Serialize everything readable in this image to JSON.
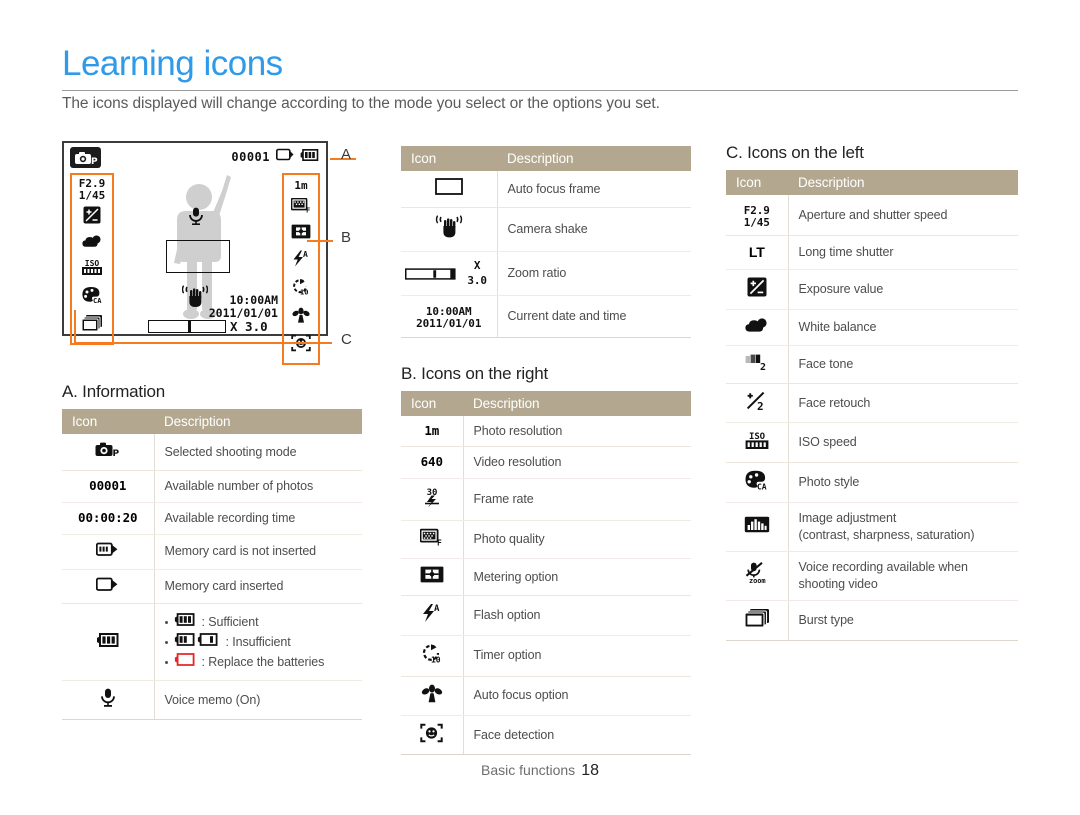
{
  "page": {
    "title": "Learning icons",
    "intro": "The icons displayed will change according to the mode you select or the options you set.",
    "footer_label": "Basic functions",
    "footer_page": "18",
    "accent_color": "#2f9ae8",
    "callout_color": "#f47b20",
    "table_header_color": "#b3a88f"
  },
  "lcd": {
    "mode_icon": "camera-program-mode-icon",
    "shots_remaining": "00001",
    "memory_card_icon": "memory-card-inserted-icon",
    "battery_icon": "battery-full-icon",
    "aperture": "F2.9",
    "shutter": "1/45",
    "zoom_ratio": "X 3.0",
    "time": "10:00AM",
    "date": "2011/01/01",
    "left_icons": [
      "exposure-value-icon",
      "white-balance-cloudy-icon",
      "iso-speed-icon",
      "photo-style-icon",
      "burst-type-icon"
    ],
    "right_icons": [
      "photo-resolution-1m-icon",
      "photo-quality-fine-icon",
      "metering-option-icon",
      "flash-auto-icon",
      "timer-10s-icon",
      "macro-af-icon",
      "face-detection-icon"
    ],
    "callouts": [
      {
        "label": "A",
        "target": "information-row"
      },
      {
        "label": "B",
        "target": "icons-on-the-right"
      },
      {
        "label": "C",
        "target": "icons-on-the-left"
      }
    ]
  },
  "tables": {
    "common_headers": {
      "icon": "Icon",
      "description": "Description"
    },
    "information": {
      "heading": "A. Information",
      "rows": [
        {
          "icon": "camera-program-mode-icon",
          "icon_text": "",
          "description": "Selected shooting mode"
        },
        {
          "icon": "shots-remaining-counter",
          "icon_text": "00001",
          "description": "Available number of photos"
        },
        {
          "icon": "recording-time-counter",
          "icon_text": "00:00:20",
          "description": "Available recording time"
        },
        {
          "icon": "memory-card-not-inserted-icon",
          "icon_text": "",
          "description": "Memory card is not inserted"
        },
        {
          "icon": "memory-card-inserted-icon",
          "icon_text": "",
          "description": "Memory card inserted"
        },
        {
          "icon": "battery-icon",
          "icon_text": "",
          "description": "",
          "bullets": [
            {
              "icon": "battery-full-icon",
              "text": ": Sufficient"
            },
            {
              "icon": "battery-low-icons",
              "text": ": Insufficient"
            },
            {
              "icon": "battery-empty-red-icon",
              "text": ": Replace the batteries"
            }
          ]
        },
        {
          "icon": "voice-memo-icon",
          "icon_text": "",
          "description": "Voice memo (On)"
        }
      ]
    },
    "middle": {
      "heading": "",
      "rows": [
        {
          "icon": "auto-focus-frame-icon",
          "icon_text": "",
          "description": "Auto focus frame"
        },
        {
          "icon": "camera-shake-icon",
          "icon_text": "",
          "description": "Camera shake"
        },
        {
          "icon": "zoom-ratio-bar-icon",
          "icon_text": "X 3.0",
          "description": "Zoom ratio"
        },
        {
          "icon": "date-time-display",
          "icon_text": "10:00AM 2011/01/01",
          "description": "Current date and time"
        }
      ]
    },
    "right_icons": {
      "heading": "B. Icons on the right",
      "rows": [
        {
          "icon": "photo-resolution-icon",
          "icon_text": "1m",
          "description": "Photo resolution"
        },
        {
          "icon": "video-resolution-icon",
          "icon_text": "640",
          "description": "Video resolution"
        },
        {
          "icon": "frame-rate-icon",
          "icon_text": "30",
          "description": "Frame rate"
        },
        {
          "icon": "photo-quality-icon",
          "icon_text": "",
          "description": "Photo quality"
        },
        {
          "icon": "metering-option-icon",
          "icon_text": "",
          "description": "Metering option"
        },
        {
          "icon": "flash-option-icon",
          "icon_text": "",
          "description": "Flash option"
        },
        {
          "icon": "timer-option-icon",
          "icon_text": "",
          "description": "Timer option"
        },
        {
          "icon": "auto-focus-option-icon",
          "icon_text": "",
          "description": "Auto focus option"
        },
        {
          "icon": "face-detection-icon",
          "icon_text": "",
          "description": "Face detection"
        }
      ]
    },
    "left_icons": {
      "heading": "C. Icons on the left",
      "rows": [
        {
          "icon": "aperture-shutter-icon",
          "icon_text": "F2.9 1/45",
          "description": "Aperture and shutter speed"
        },
        {
          "icon": "long-time-shutter-icon",
          "icon_text": "LT",
          "description": "Long time shutter"
        },
        {
          "icon": "exposure-value-icon",
          "icon_text": "",
          "description": "Exposure value"
        },
        {
          "icon": "white-balance-icon",
          "icon_text": "",
          "description": "White balance"
        },
        {
          "icon": "face-tone-icon",
          "icon_text": "",
          "description": "Face tone"
        },
        {
          "icon": "face-retouch-icon",
          "icon_text": "",
          "description": "Face retouch"
        },
        {
          "icon": "iso-speed-icon",
          "icon_text": "",
          "description": "ISO speed"
        },
        {
          "icon": "photo-style-icon",
          "icon_text": "",
          "description": "Photo style"
        },
        {
          "icon": "image-adjustment-icon",
          "icon_text": "",
          "description": "Image adjustment\n(contrast, sharpness, saturation)"
        },
        {
          "icon": "voice-recording-icon",
          "icon_text": "",
          "description": "Voice recording available when\nshooting video"
        },
        {
          "icon": "burst-type-icon",
          "icon_text": "",
          "description": "Burst type"
        }
      ]
    }
  }
}
